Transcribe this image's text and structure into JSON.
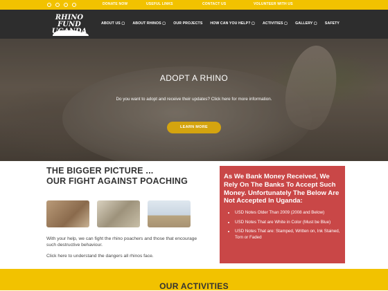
{
  "topbar": {
    "social_icons": [
      "social-circle-icon",
      "social-circle-icon",
      "social-circle-icon",
      "social-circle-icon"
    ],
    "links": [
      "DONATE NOW",
      "USEFUL LINKS",
      "CONTACT US",
      "VOLUNTEER WITH US"
    ]
  },
  "header": {
    "logo_line1": "RHINO FUND",
    "logo_line2": "UGANDA",
    "menu": [
      "ABOUT US",
      "ABOUT RHINOS",
      "OUR PROJECTS",
      "HOW CAN YOU HELP?",
      "ACTIVITIES",
      "GALLERY",
      "SAFETY"
    ],
    "dropdown_marker": "▢"
  },
  "hero": {
    "title": "ADOPT A RHINO",
    "text": "Do you want to adopt and receive their updates? Click here for more information.",
    "button": "LEARN MORE"
  },
  "main": {
    "heading_line1": "THE BIGGER PICTURE ...",
    "heading_line2": "OUR FIGHT AGAINST POACHING",
    "para1": "With your help, we can fight the rhino poachers and those that encourage such destructive behaviour.",
    "para2": "Click here to understand the dangers all rhinos face."
  },
  "notice": {
    "heading": "As We Bank Money Received, We Rely On The Banks To Accept Such Money. Unfortunately The Below Are Not Accepted In Uganda:",
    "items": [
      "USD Notes Older Than 2009 (2008 and Below)",
      "USD Notes That are White in Color (Must be Blue)",
      "USD Notes That are: Stamped, Written on, Ink Stained, Torn or Faded"
    ]
  },
  "activities": {
    "title": "OUR ACTIVITIES"
  },
  "colors": {
    "accent": "#f2c200",
    "nav": "#2d2d2d",
    "notice": "#c94747",
    "button": "#d4a40f"
  }
}
